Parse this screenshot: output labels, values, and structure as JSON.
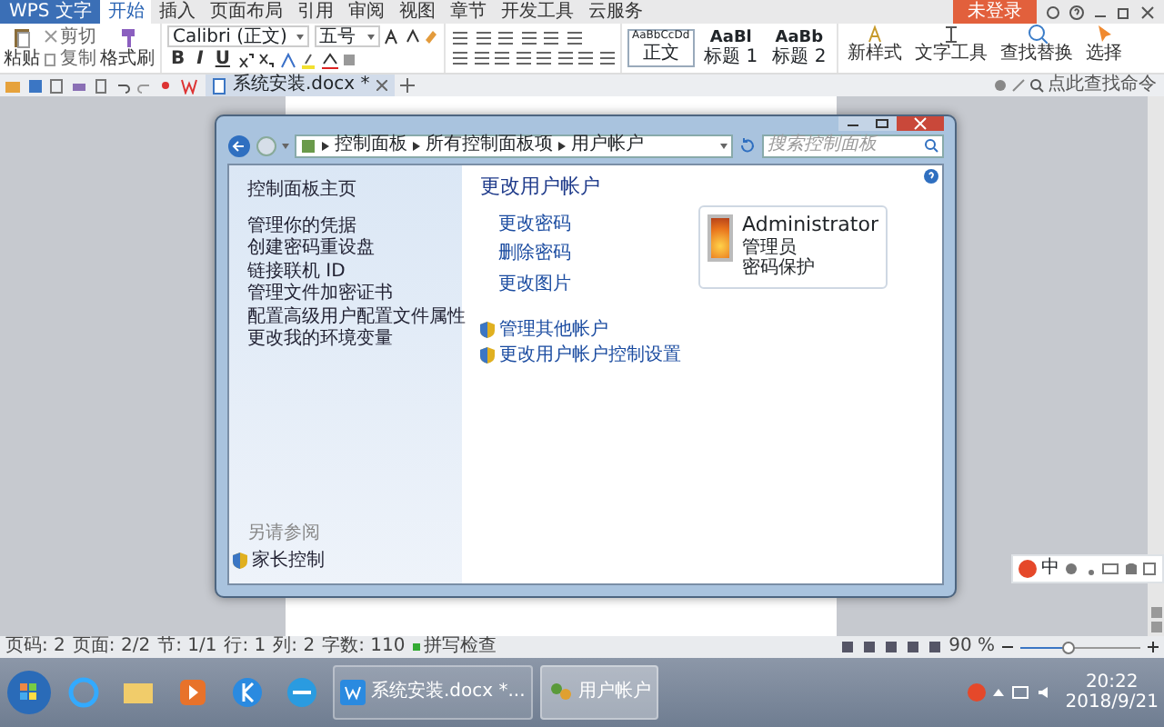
{
  "app": {
    "logo": "WPS 文字",
    "login": "未登录",
    "tabs": [
      {
        "label": "开始",
        "selected": true
      },
      {
        "label": "插入",
        "selected": false
      },
      {
        "label": "页面布局",
        "selected": false
      },
      {
        "label": "引用",
        "selected": false
      },
      {
        "label": "审阅",
        "selected": false
      },
      {
        "label": "视图",
        "selected": false
      },
      {
        "label": "章节",
        "selected": false
      },
      {
        "label": "开发工具",
        "selected": false
      },
      {
        "label": "云服务",
        "selected": false
      }
    ]
  },
  "ribbon": {
    "paste": "粘贴",
    "cut": "剪切",
    "copy": "复制",
    "format_painter": "格式刷",
    "font": "Calibri (正文)",
    "size": "五号",
    "format_buttons": [
      "B",
      "I",
      "U"
    ],
    "styles": [
      {
        "sample": "AaBbCcDd",
        "label": "正文",
        "selected": true
      },
      {
        "sample": "AaBl",
        "label": "标题 1",
        "selected": false
      },
      {
        "sample": "AaBb",
        "label": "标题 2",
        "selected": false
      }
    ],
    "tools": [
      "新样式",
      "文字工具",
      "查找替换",
      "选择"
    ]
  },
  "doc_tabs": [
    {
      "label": "系统安装.docx *",
      "selected": true
    }
  ],
  "command_search": {
    "placeholder": "点此查找命令"
  },
  "dialog": {
    "breadcrumb": [
      "控制面板",
      "所有控制面板项",
      "用户帐户"
    ],
    "search": {
      "placeholder": "搜索控制面板"
    },
    "sidebar": {
      "home": "控制面板主页",
      "links": [
        "管理你的凭据",
        "创建密码重设盘",
        "链接联机 ID",
        "管理文件加密证书",
        "配置高级用户配置文件属性",
        "更改我的环境变量"
      ],
      "see_also_title": "另请参阅",
      "see_also": [
        "家长控制"
      ]
    },
    "heading": "更改用户帐户",
    "actions": [
      "更改密码",
      "删除密码",
      "更改图片"
    ],
    "shield_links": [
      "管理其他帐户",
      "更改用户帐户控制设置"
    ],
    "account": {
      "name": "Administrator",
      "role": "管理员",
      "status": "密码保护"
    }
  },
  "ime": {
    "mode": "中"
  },
  "status_bar": {
    "items": [
      "页码: 2",
      "页面: 2/2",
      "节: 1/1",
      "行: 1",
      "列: 2",
      "字数: 110"
    ],
    "spell_check": "拼写检查",
    "zoom": "90 %",
    "level": 0.4
  },
  "taskbar": {
    "windows": [
      {
        "label": "系统安装.docx *...",
        "selected": false
      },
      {
        "label": "用户帐户",
        "selected": true
      }
    ],
    "time": "20:22",
    "date": "2018/9/21"
  }
}
